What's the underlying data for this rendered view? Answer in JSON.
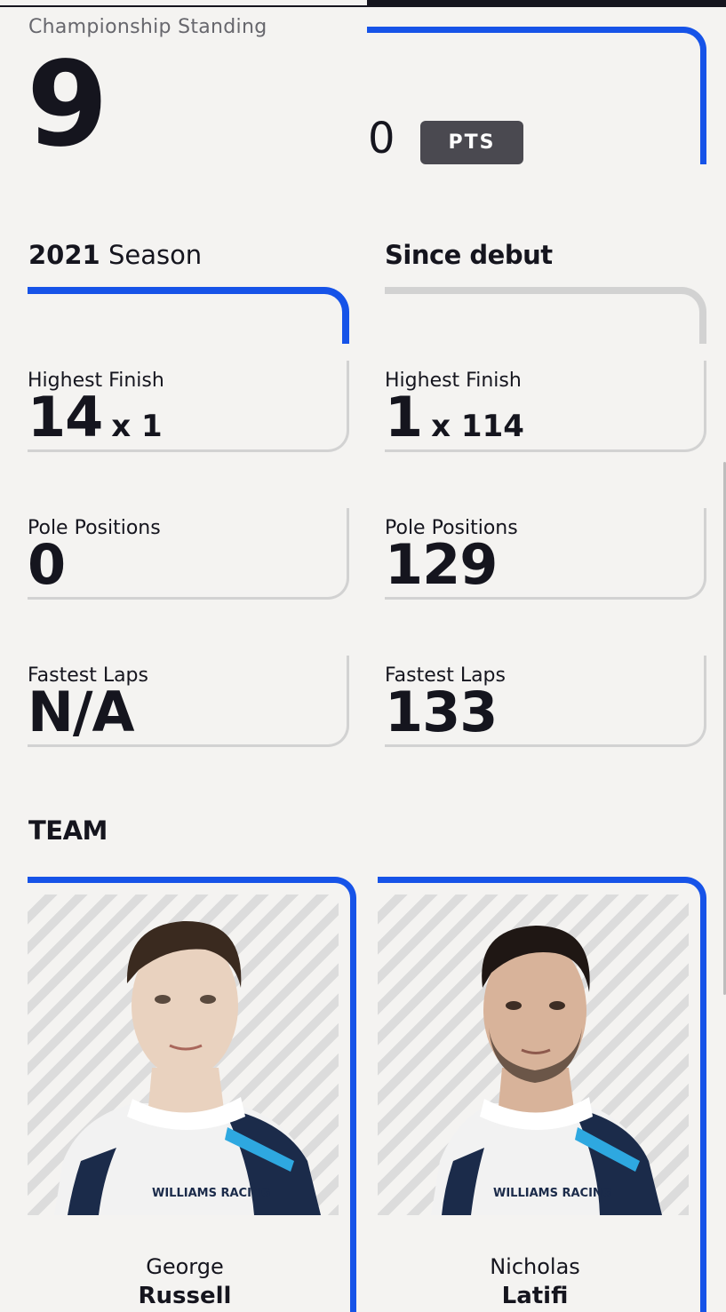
{
  "standing": {
    "label": "Championship Standing",
    "position": "9",
    "points": "0",
    "points_unit": "PTS"
  },
  "columns": {
    "season_year": "2021",
    "season_word": "Season",
    "debut_label": "Since debut"
  },
  "stats": {
    "season": {
      "highest_finish_label": "Highest Finish",
      "highest_finish_value": "14",
      "highest_finish_mult": "x 1",
      "pole_label": "Pole Positions",
      "pole_value": "0",
      "fastest_label": "Fastest Laps",
      "fastest_value": "N/A"
    },
    "debut": {
      "highest_finish_label": "Highest Finish",
      "highest_finish_value": "1",
      "highest_finish_mult": "x 114",
      "pole_label": "Pole Positions",
      "pole_value": "129",
      "fastest_label": "Fastest Laps",
      "fastest_value": "133"
    }
  },
  "team": {
    "title": "TEAM",
    "drivers": [
      {
        "first": "George",
        "last": "Russell",
        "suit_logo": "WILLIAMS RACING"
      },
      {
        "first": "Nicholas",
        "last": "Latifi",
        "suit_logo": "WILLIAMS RACING"
      }
    ]
  },
  "colors": {
    "accent": "#1653e8",
    "text": "#15151e",
    "muted": "#67676d",
    "badge": "#4a4950",
    "divider": "#d2d2d2",
    "background": "#f4f3f1"
  }
}
